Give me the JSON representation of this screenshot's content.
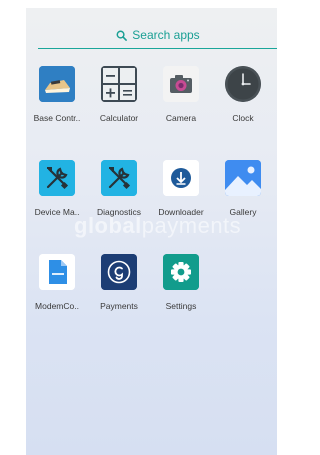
{
  "search": {
    "placeholder": "Search apps",
    "icon": "search-icon",
    "accent_color": "#1a9f94"
  },
  "wallpaper": {
    "brand_regular_left": "global",
    "brand_regular_right": "payments"
  },
  "apps": [
    {
      "label": "Base Contr..",
      "icon": "base-control-icon"
    },
    {
      "label": "Calculator",
      "icon": "calculator-icon"
    },
    {
      "label": "Camera",
      "icon": "camera-icon"
    },
    {
      "label": "Clock",
      "icon": "clock-icon"
    },
    {
      "label": "Device Ma..",
      "icon": "device-manager-icon"
    },
    {
      "label": "Diagnostics",
      "icon": "diagnostics-icon"
    },
    {
      "label": "Downloader",
      "icon": "downloader-icon"
    },
    {
      "label": "Gallery",
      "icon": "gallery-icon"
    },
    {
      "label": "ModemCo..",
      "icon": "modem-config-icon"
    },
    {
      "label": "Payments",
      "icon": "payments-icon"
    },
    {
      "label": "Settings",
      "icon": "settings-icon"
    }
  ]
}
